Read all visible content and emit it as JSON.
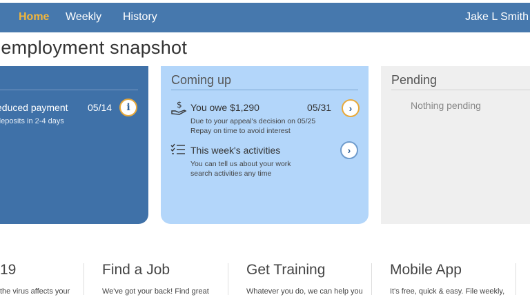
{
  "nav": {
    "items": [
      {
        "label": "Home",
        "active": true
      },
      {
        "label": "Weekly",
        "active": false
      },
      {
        "label": "History",
        "active": false
      }
    ],
    "user_name": "Jake L Smith"
  },
  "page": {
    "title": "nemployment snapshot"
  },
  "cards": {
    "latest": {
      "payment_label": "educed payment",
      "payment_date": "05/14",
      "payment_sub": "deposits in 2-4 days",
      "info_icon": "i"
    },
    "coming_up": {
      "title": "Coming up",
      "owe": {
        "title": "You owe $1,290",
        "date": "05/31",
        "desc1": "Due to your appeal's decision on 05/25",
        "desc2": "Repay on time to avoid interest"
      },
      "activities": {
        "title": "This week's activities",
        "desc1": "You can tell us about your work",
        "desc2": "search activities any time"
      }
    },
    "pending": {
      "title": "Pending",
      "empty_text": "Nothing pending"
    }
  },
  "bottom": [
    {
      "title": "19",
      "text": "the virus affects your"
    },
    {
      "title": "Find a Job",
      "text": "We've got your back! Find great"
    },
    {
      "title": "Get Training",
      "text": "Whatever you do, we can help you"
    },
    {
      "title": "Mobile App",
      "text": "It's free, quick & easy. File weekly,"
    }
  ],
  "colors": {
    "header": "#4678ad",
    "active_nav": "#f1b63c",
    "card_dark": "#3f71a8",
    "card_light": "#b3d6fa",
    "card_gray": "#efefef",
    "accent_orange": "#e8a93a"
  },
  "icons": {
    "arrow": "›",
    "money": "hand-money-icon",
    "checklist": "checklist-icon"
  }
}
